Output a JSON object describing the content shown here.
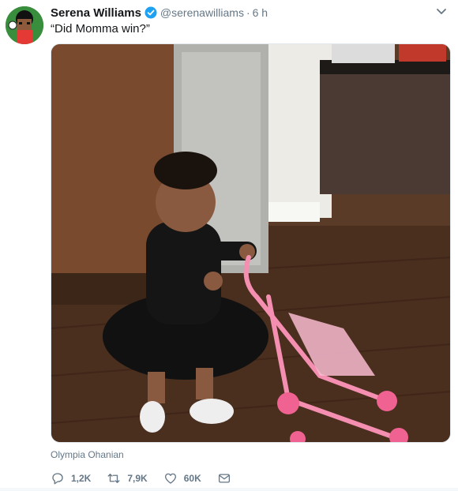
{
  "tweet": {
    "author_name": "Serena Williams",
    "handle": "@serenawilliams",
    "separator": "·",
    "time": "6 h",
    "text": "“Did Momma win?”",
    "photo_credit": "Olympia Ohanian",
    "verified": true
  },
  "actions": {
    "reply_count": "1,2K",
    "retweet_count": "7,9K",
    "like_count": "60K"
  },
  "icons": {
    "verified": "verified-badge-icon",
    "caret": "chevron-down-icon",
    "reply": "reply-icon",
    "retweet": "retweet-icon",
    "like": "heart-icon",
    "dm": "envelope-icon"
  },
  "colors": {
    "verified_blue": "#1da1f2",
    "text_secondary": "#657786",
    "text_primary": "#14171a"
  }
}
